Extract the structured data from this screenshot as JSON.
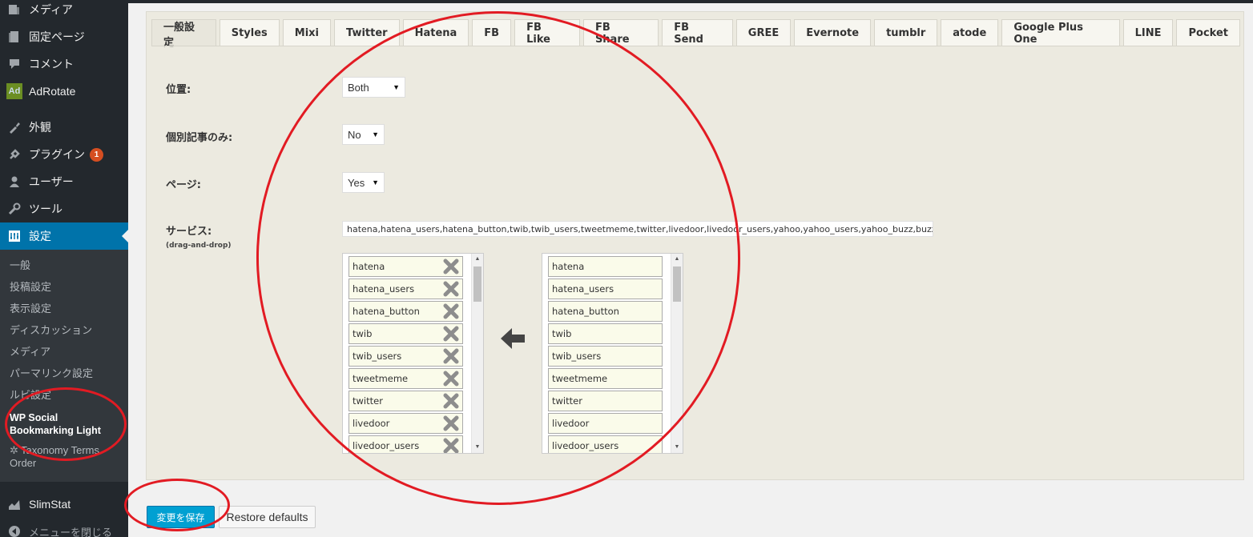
{
  "sidebar": {
    "items": [
      {
        "label": "メディア",
        "icon": "media-icon"
      },
      {
        "label": "固定ページ",
        "icon": "pages-icon"
      },
      {
        "label": "コメント",
        "icon": "comments-icon"
      },
      {
        "label": "AdRotate",
        "icon": "adrotate-icon",
        "icon_text": "Ad"
      },
      {
        "label": "外観",
        "icon": "appearance-icon"
      },
      {
        "label": "プラグイン",
        "icon": "plugins-icon",
        "badge": "1"
      },
      {
        "label": "ユーザー",
        "icon": "users-icon"
      },
      {
        "label": "ツール",
        "icon": "tools-icon"
      },
      {
        "label": "設定",
        "icon": "settings-icon"
      },
      {
        "label": "SlimStat",
        "icon": "slimstat-icon"
      },
      {
        "label": "メニューを閉じる",
        "icon": "collapse-icon"
      }
    ],
    "submenu": [
      {
        "label": "一般"
      },
      {
        "label": "投稿設定"
      },
      {
        "label": "表示設定"
      },
      {
        "label": "ディスカッション"
      },
      {
        "label": "メディア"
      },
      {
        "label": "パーマリンク設定"
      },
      {
        "label": "ルビ設定"
      },
      {
        "label": "WP Social Bookmarking Light"
      },
      {
        "label": "Taxonomy Terms Order"
      }
    ]
  },
  "tabs": [
    "一般設定",
    "Styles",
    "Mixi",
    "Twitter",
    "Hatena",
    "FB",
    "FB Like",
    "FB Share",
    "FB Send",
    "GREE",
    "Evernote",
    "tumblr",
    "atode",
    "Google Plus One",
    "LINE",
    "Pocket"
  ],
  "form": {
    "position_label": "位置:",
    "position_value": "Both",
    "single_label": "個別記事のみ:",
    "single_value": "No",
    "page_label": "ページ:",
    "page_value": "Yes",
    "services_label": "サービス:",
    "services_hint": "(drag-and-drop)",
    "services_value": "hatena,hatena_users,hatena_button,twib,twib_users,tweetmeme,twitter,livedoor,livedoor_users,yahoo,yahoo_users,yahoo_buzz,buzz"
  },
  "selected_services": [
    "hatena",
    "hatena_users",
    "hatena_button",
    "twib",
    "twib_users",
    "tweetmeme",
    "twitter",
    "livedoor",
    "livedoor_users"
  ],
  "available_services": [
    "hatena",
    "hatena_users",
    "hatena_button",
    "twib",
    "twib_users",
    "tweetmeme",
    "twitter",
    "livedoor",
    "livedoor_users"
  ],
  "buttons": {
    "save": "変更を保存",
    "restore": "Restore defaults"
  },
  "colors": {
    "annotation": "#e21b23",
    "accent": "#0073aa"
  }
}
